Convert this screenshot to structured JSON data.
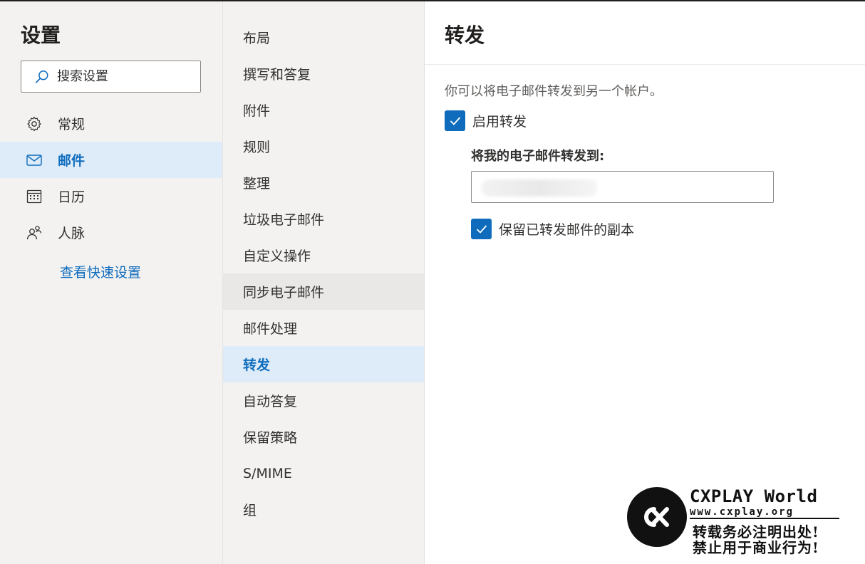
{
  "settings": {
    "title": "设置",
    "search_placeholder": "搜索设置",
    "nav": [
      {
        "label": "常规",
        "icon": "gear-icon"
      },
      {
        "label": "邮件",
        "icon": "mail-icon",
        "active": true
      },
      {
        "label": "日历",
        "icon": "calendar-icon"
      },
      {
        "label": "人脉",
        "icon": "people-icon"
      }
    ],
    "quick_settings_link": "查看快速设置"
  },
  "mail_nav": [
    "布局",
    "撰写和答复",
    "附件",
    "规则",
    "整理",
    "垃圾电子邮件",
    "自定义操作",
    "同步电子邮件",
    "邮件处理",
    "转发",
    "自动答复",
    "保留策略",
    "S/MIME",
    "组"
  ],
  "mail_nav_active": "转发",
  "mail_nav_hover": "同步电子邮件",
  "forwarding": {
    "title": "转发",
    "description": "你可以将电子邮件转发到另一个帐户。",
    "enable_label": "启用转发",
    "enable_checked": true,
    "forward_to_label": "将我的电子邮件转发到:",
    "forward_to_value": "",
    "keep_copy_label": "保留已转发邮件的副本",
    "keep_copy_checked": true
  },
  "watermark": {
    "brand": "CXPLAY World",
    "url": "www.cxplay.org",
    "line1": "转载务必注明出处!",
    "line2": "禁止用于商业行为!"
  },
  "colors": {
    "accent": "#0f6cbd",
    "active_bg": "#deecf9",
    "sidebar_bg": "#f3f2f1"
  }
}
